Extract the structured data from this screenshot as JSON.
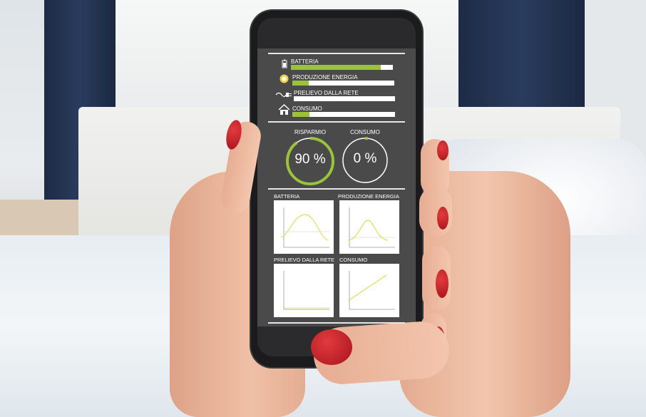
{
  "rows": [
    {
      "label": "BATTERIA",
      "level": 0.88,
      "icon": "battery-icon"
    },
    {
      "label": "PRODUZIONE ENERGIA",
      "level": 0.16,
      "icon": "sun-icon"
    },
    {
      "label": "PRELIEVO DALLA RETE",
      "level": 0.0,
      "icon": "plug-icon"
    },
    {
      "label": "CONSUMO",
      "level": 0.17,
      "icon": "house-icon"
    }
  ],
  "gauges": [
    {
      "label": "RISPARMIO",
      "value": "90 %",
      "level": 0.9
    },
    {
      "label": "CONSUMO",
      "value": "0 %",
      "level": 0.02
    }
  ],
  "charts": [
    {
      "label": "BATTERIA",
      "shape": "hump-wide"
    },
    {
      "label": "PRODUZIONE ENERGIA",
      "shape": "hump-narrow"
    },
    {
      "label": "PRELIEVO DALLA RETE",
      "shape": "flat"
    },
    {
      "label": "CONSUMO",
      "shape": "linear"
    }
  ],
  "colors": {
    "accent": "#9bc33a",
    "screen": "#4a4a4a",
    "curve": "#e3e07a"
  }
}
